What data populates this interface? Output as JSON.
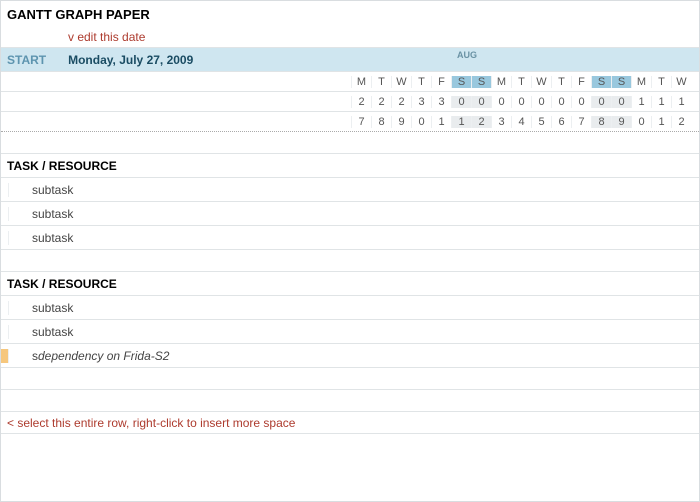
{
  "title": "GANTT GRAPH PAPER",
  "edit_hint": "v edit this date",
  "start_label": "START",
  "start_date": "Monday, July 27, 2009",
  "month_label": "AUG",
  "day_letters": [
    "M",
    "T",
    "W",
    "T",
    "F",
    "S",
    "S",
    "M",
    "T",
    "W",
    "T",
    "F",
    "S",
    "S",
    "M",
    "T",
    "W"
  ],
  "date_row1": [
    "2",
    "2",
    "2",
    "3",
    "3",
    "0",
    "0",
    "0",
    "0",
    "0",
    "0",
    "0",
    "0",
    "0",
    "1",
    "1",
    "1"
  ],
  "date_row2": [
    "7",
    "8",
    "9",
    "0",
    "1",
    "1",
    "2",
    "3",
    "4",
    "5",
    "6",
    "7",
    "8",
    "9",
    "0",
    "1",
    "2"
  ],
  "weekend_idx": [
    5,
    6,
    12,
    13
  ],
  "sections": [
    {
      "header": "TASK / RESOURCE",
      "rows": [
        {
          "type": "subtask",
          "text": "subtask"
        },
        {
          "type": "subtask",
          "text": "subtask"
        },
        {
          "type": "subtask",
          "text": "subtask"
        }
      ]
    },
    {
      "header": "TASK / RESOURCE",
      "rows": [
        {
          "type": "subtask",
          "text": "subtask"
        },
        {
          "type": "subtask",
          "text": "subtask"
        },
        {
          "type": "dep",
          "prefix": "su",
          "text": "dependency on Frida-S2"
        }
      ]
    }
  ],
  "insert_hint": "< select this entire row, right-click to insert more space"
}
